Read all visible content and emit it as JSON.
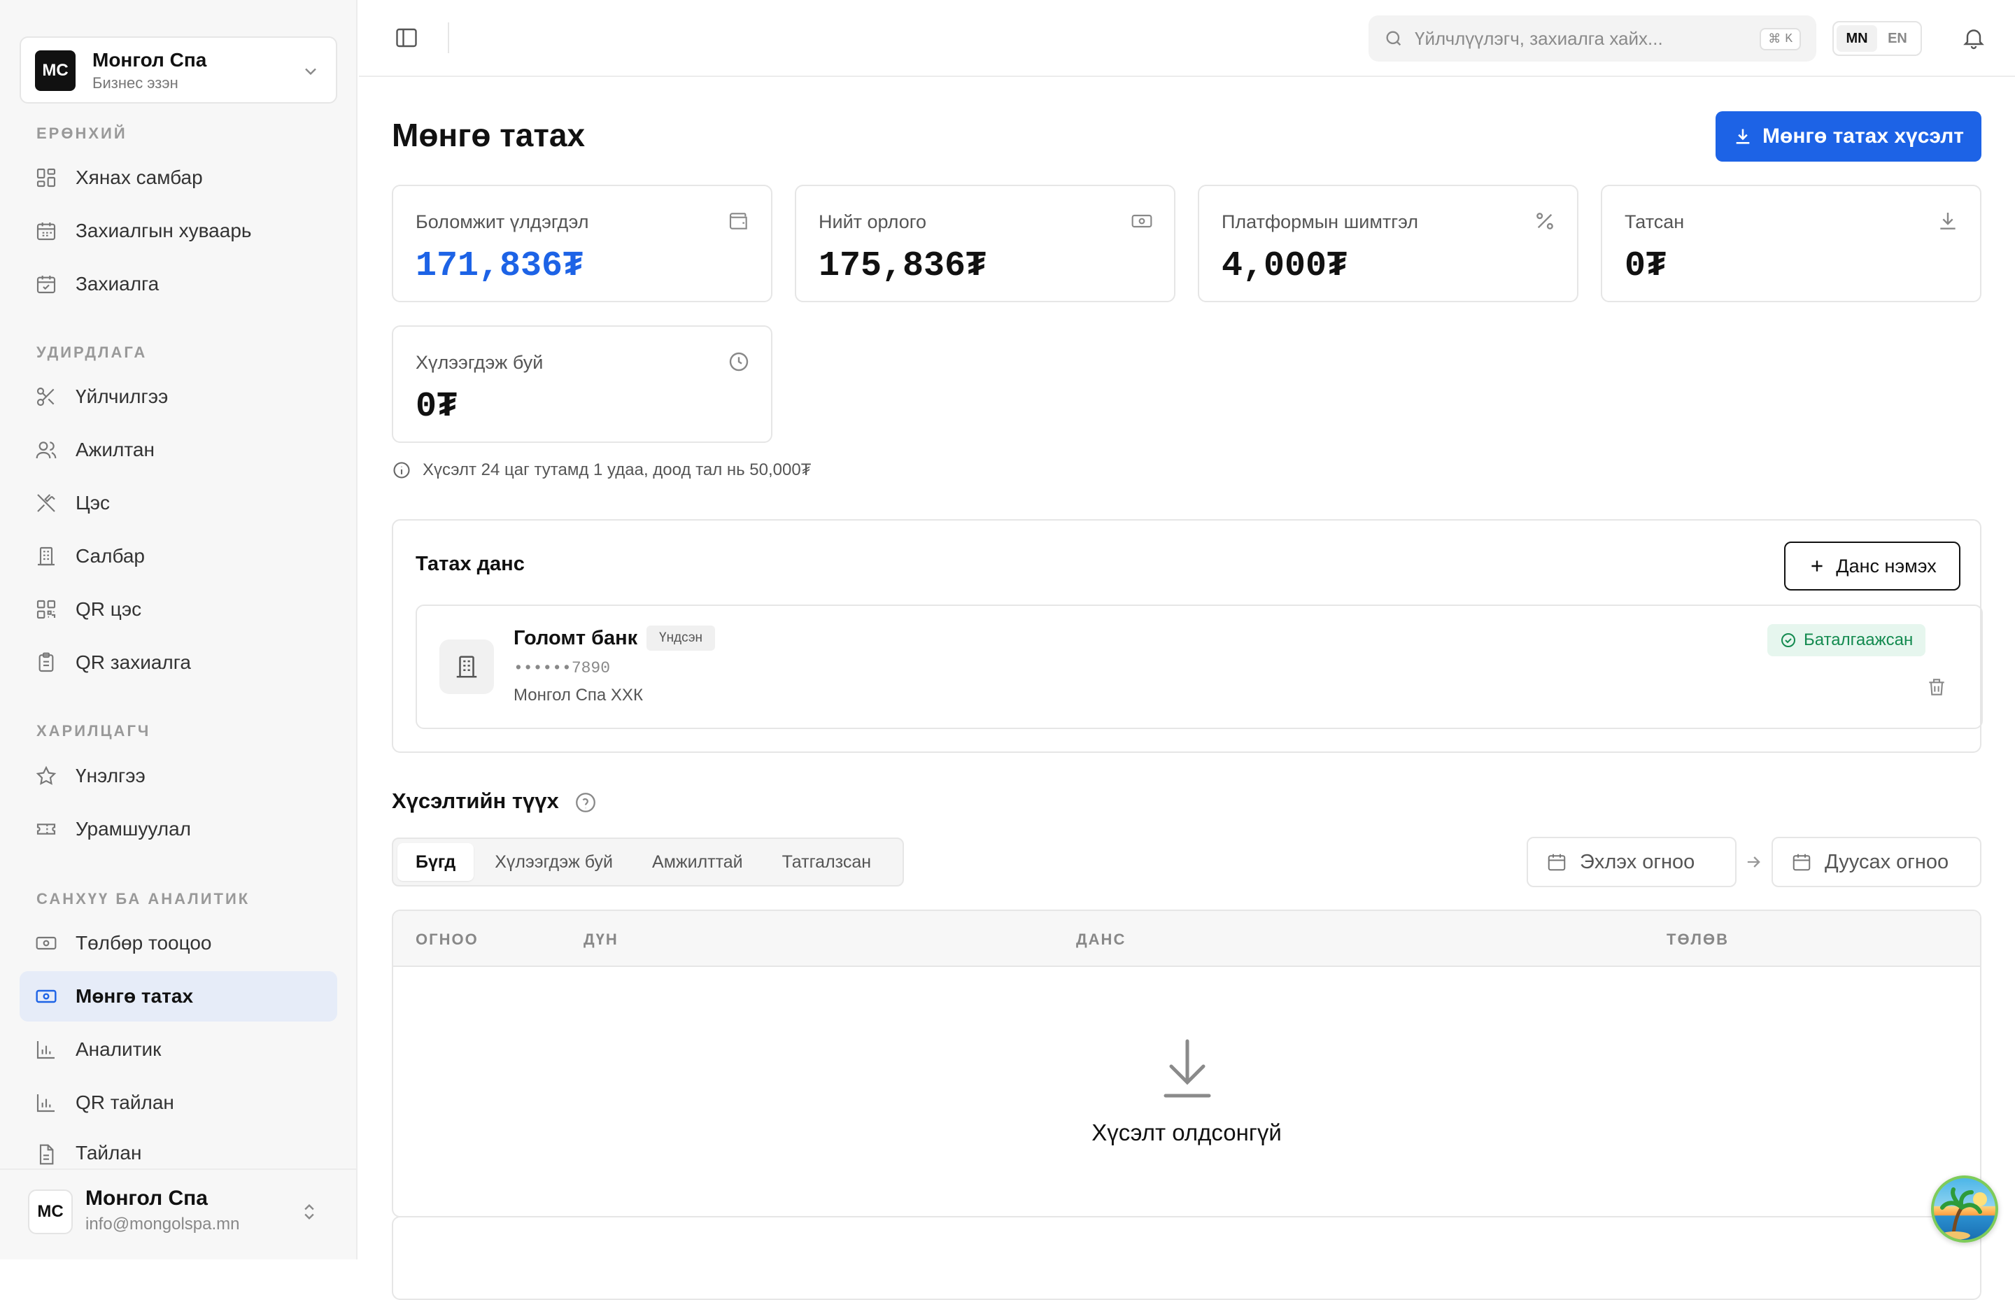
{
  "sidebar": {
    "business": {
      "initials": "MC",
      "name": "Монгол Спа",
      "role": "Бизнес эзэн"
    },
    "sections": [
      {
        "label": "ЕРӨНХИЙ",
        "items": [
          {
            "label": "Хянах самбар",
            "icon": "dashboard-icon"
          },
          {
            "label": "Захиалгын хуваарь",
            "icon": "calendar-icon"
          },
          {
            "label": "Захиалга",
            "icon": "calendar-check-icon"
          }
        ]
      },
      {
        "label": "УДИРДЛАГА",
        "items": [
          {
            "label": "Үйлчилгээ",
            "icon": "scissors-icon"
          },
          {
            "label": "Ажилтан",
            "icon": "users-icon"
          },
          {
            "label": "Цэс",
            "icon": "utensils-icon"
          },
          {
            "label": "Салбар",
            "icon": "building-icon"
          },
          {
            "label": "QR цэс",
            "icon": "qr-icon"
          },
          {
            "label": "QR захиалга",
            "icon": "clipboard-icon"
          }
        ]
      },
      {
        "label": "ХАРИЛЦАГЧ",
        "items": [
          {
            "label": "Үнэлгээ",
            "icon": "star-icon"
          },
          {
            "label": "Урамшуулал",
            "icon": "ticket-icon"
          }
        ]
      },
      {
        "label": "САНХҮҮ БА АНАЛИТИК",
        "items": [
          {
            "label": "Төлбөр тооцоо",
            "icon": "banknote-icon"
          },
          {
            "label": "Мөнгө татах",
            "icon": "banknote-icon",
            "active": true
          },
          {
            "label": "Аналитик",
            "icon": "bar-chart-icon"
          },
          {
            "label": "QR тайлан",
            "icon": "bar-chart-icon"
          },
          {
            "label": "Тайлан",
            "icon": "file-icon"
          }
        ]
      }
    ],
    "footer": {
      "initials": "MC",
      "name": "Монгол Спа",
      "email": "info@mongolspa.mn"
    }
  },
  "topbar": {
    "search_placeholder": "Үйлчлүүлэгч, захиалга хайх...",
    "shortcut_symbol": "⌘",
    "shortcut_key": "K",
    "lang": [
      "MN",
      "EN"
    ],
    "active_lang": "MN"
  },
  "page": {
    "title": "Мөнгө татах",
    "primary_action": "Мөнгө татах хүсэлт",
    "accent": "#1d63e6"
  },
  "stats": [
    {
      "label": "Боломжит үлдэгдэл",
      "value": "171,836₮",
      "icon": "wallet-icon",
      "highlight": true
    },
    {
      "label": "Нийт орлого",
      "value": "175,836₮",
      "icon": "banknote-icon"
    },
    {
      "label": "Платформын шимтгэл",
      "value": "4,000₮",
      "icon": "percent-icon"
    },
    {
      "label": "Татсан",
      "value": "0₮",
      "icon": "download-icon"
    },
    {
      "label": "Хүлээгдэж буй",
      "value": "0₮",
      "icon": "clock-icon"
    }
  ],
  "info_note": "Хүсэлт 24 цаг тутамд 1 удаа, доод тал нь 50,000₮",
  "accounts_card": {
    "title": "Татах данс",
    "add_button": "Данс нэмэх",
    "account": {
      "bank": "Голомт банк",
      "badge": "Үндсэн",
      "number": "••••••7890",
      "owner": "Монгол Спа ХХК",
      "status": "Баталгаажсан",
      "status_color": "#138a4f"
    }
  },
  "history": {
    "title": "Хүсэлтийн түүх",
    "tabs": [
      "Бүгд",
      "Хүлээгдэж буй",
      "Амжилттай",
      "Татгалзсан"
    ],
    "active_tab": "Бүгд",
    "start_date_placeholder": "Эхлэх огноо",
    "end_date_placeholder": "Дуусах огноо",
    "columns": [
      "ОГНОО",
      "ДҮН",
      "ДАНС",
      "ТӨЛӨВ"
    ],
    "empty_text": "Хүсэлт олдсонгүй"
  }
}
